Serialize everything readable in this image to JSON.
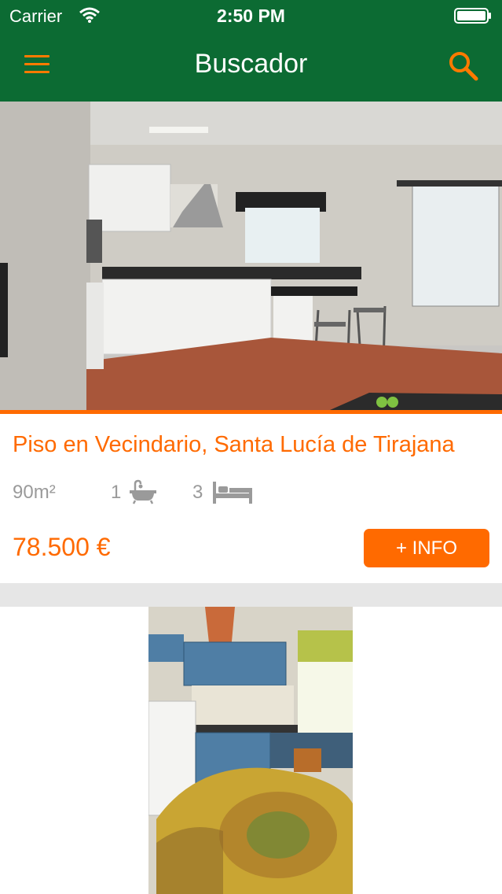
{
  "status_bar": {
    "carrier": "Carrier",
    "time": "2:50 PM",
    "wifi_icon": "wifi-icon",
    "battery_icon": "battery-icon"
  },
  "nav": {
    "title": "Buscador",
    "menu_icon": "menu-icon",
    "search_icon": "search-icon"
  },
  "listings": [
    {
      "title": "Piso en Vecindario, Santa Lucía de Tirajana",
      "area": "90m²",
      "bathrooms": "1",
      "bedrooms": "3",
      "price": "78.500 €",
      "info_button": "+ INFO",
      "photo": "kitchen-photo"
    },
    {
      "photo": "living-room-photo"
    }
  ],
  "colors": {
    "header_bg": "#0c6b33",
    "accent": "#ff6a00",
    "separator": "#e6e6e6",
    "muted_text": "#9a9a9a"
  }
}
